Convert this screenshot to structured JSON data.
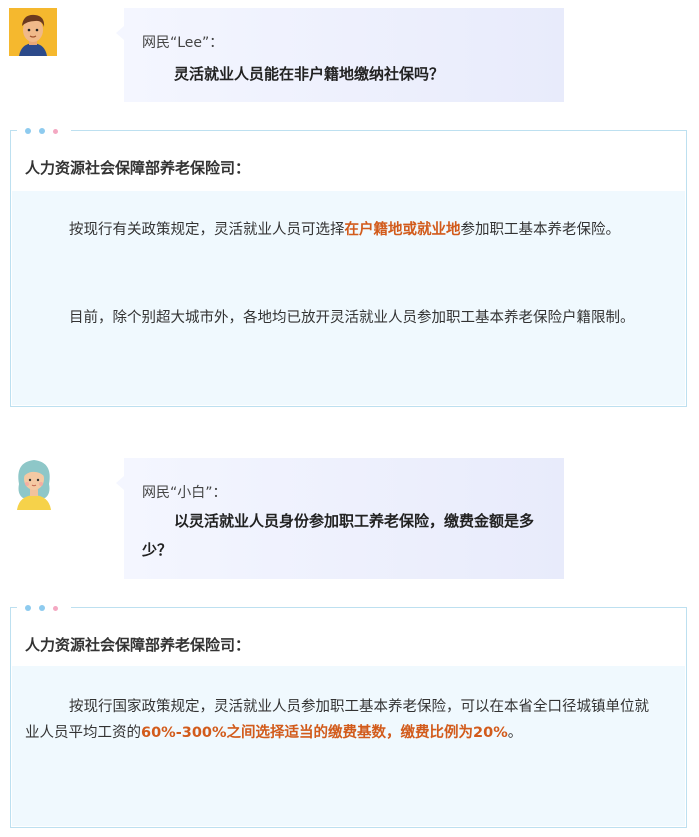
{
  "q1": {
    "name": "网民“Lee”：",
    "text": "灵活就业人员能在非户籍地缴纳社保吗？"
  },
  "a1": {
    "title": "人力资源社会保障部养老保险司：",
    "p1": {
      "before": "按现行有关政策规定，灵活就业人员可选择",
      "highlight": "在户籍地或就业地",
      "after": "参加职工基本养老保险。"
    },
    "p2": "目前，除个别超大城市外，各地均已放开灵活就业人员参加职工基本养老保险户籍限制。"
  },
  "q2": {
    "name": "网民“小白”：",
    "text": "以灵活就业人员身份参加职工养老保险，缴费金额是多少？"
  },
  "a2": {
    "title": "人力资源社会保障部养老保险司：",
    "p1": {
      "before": "按现行国家政策规定，灵活就业人员参加职工基本养老保险，可以在本省全口径城镇单位就业人员平均工资的",
      "highlight": "60%-300%之间选择适当的缴费基数，缴费比例为20%",
      "after": "。"
    }
  },
  "colors": {
    "highlight": "#d25b1b",
    "card_border": "#bde0f0",
    "card_body": "#f0f9fe",
    "bubble": "#eef0fc"
  },
  "icons": {
    "avatar1": "man-avatar-icon",
    "avatar2": "woman-avatar-icon"
  }
}
